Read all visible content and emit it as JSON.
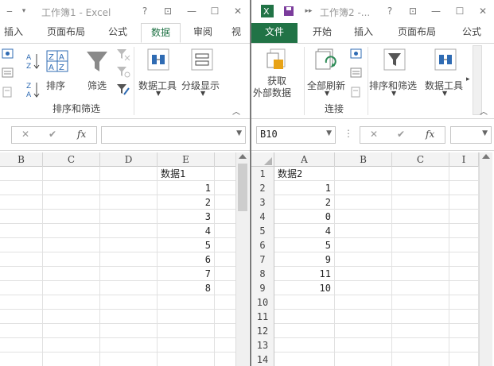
{
  "left": {
    "title": "工作簿1 - Excel",
    "tabs": [
      "插入",
      "页面布局",
      "公式",
      "数据",
      "审阅",
      "视"
    ],
    "ribbon": {
      "sort_label": "排序",
      "filter_label": "筛选",
      "data_tools_label": "数据工具",
      "outline_label": "分级显示",
      "group_label": "排序和筛选"
    },
    "formula": {
      "fx": "fx"
    },
    "columns": [
      "B",
      "C",
      "D",
      "E"
    ],
    "rows": [
      {
        "e": "数据1"
      },
      {
        "e": "1"
      },
      {
        "e": "2"
      },
      {
        "e": "3"
      },
      {
        "e": "4"
      },
      {
        "e": "5"
      },
      {
        "e": "6"
      },
      {
        "e": "7"
      },
      {
        "e": "8"
      },
      {
        "e": ""
      },
      {
        "e": ""
      },
      {
        "e": ""
      },
      {
        "e": ""
      },
      {
        "e": ""
      }
    ]
  },
  "right": {
    "title": "工作簿2 -...",
    "tabs": [
      "文件",
      "开始",
      "插入",
      "页面布局",
      "公式"
    ],
    "ribbon": {
      "get_data_line1": "获取",
      "get_data_line2": "外部数据",
      "refresh_label": "全部刷新",
      "sort_filter_label": "排序和筛选",
      "data_tools_label": "数据工具",
      "group_label": "连接"
    },
    "name_box": "B10",
    "formula": {
      "fx": "fx"
    },
    "columns": [
      "A",
      "B",
      "C",
      "I"
    ],
    "rows": [
      {
        "n": "1",
        "a": "数据2"
      },
      {
        "n": "2",
        "a": "1"
      },
      {
        "n": "3",
        "a": "2"
      },
      {
        "n": "4",
        "a": "0"
      },
      {
        "n": "5",
        "a": "4"
      },
      {
        "n": "6",
        "a": "5"
      },
      {
        "n": "7",
        "a": "9"
      },
      {
        "n": "8",
        "a": "11"
      },
      {
        "n": "9",
        "a": "10"
      },
      {
        "n": "10",
        "a": ""
      },
      {
        "n": "11",
        "a": ""
      },
      {
        "n": "12",
        "a": ""
      },
      {
        "n": "13",
        "a": ""
      },
      {
        "n": "14",
        "a": ""
      }
    ]
  },
  "colors": {
    "accent": "#217346"
  }
}
